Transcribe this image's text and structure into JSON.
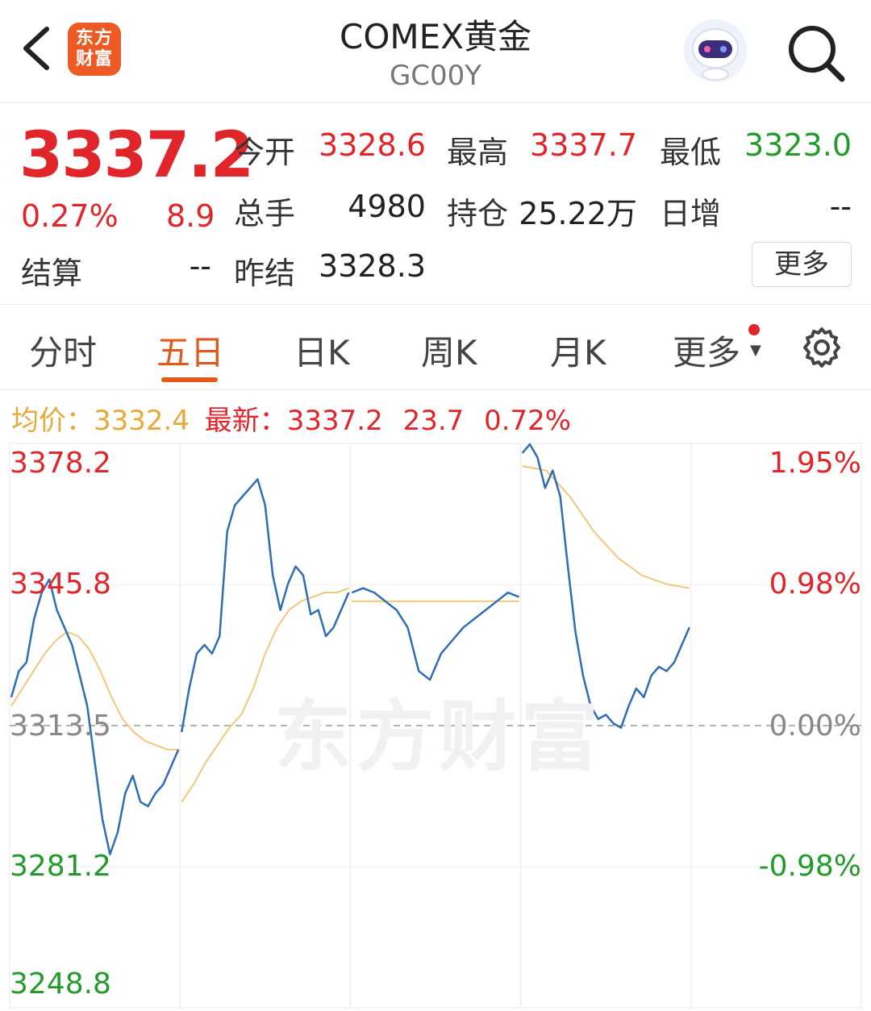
{
  "header": {
    "logo_line1": "东方",
    "logo_line2": "财富",
    "title": "COMEX黄金",
    "code": "GC00Y"
  },
  "quote": {
    "price": "3337.2",
    "change_pct": "0.27%",
    "change": "8.9",
    "open_label": "今开",
    "open": "3328.6",
    "high_label": "最高",
    "high": "3337.7",
    "low_label": "最低",
    "low": "3323.0",
    "volume_label": "总手",
    "volume": "4980",
    "oi_label": "持仓",
    "oi": "25.22万",
    "daily_inc_label": "日增",
    "daily_inc": "--",
    "settle_label": "结算",
    "settle": "--",
    "prev_settle_label": "昨结",
    "prev_settle": "3328.3",
    "more_button": "更多"
  },
  "tabs": [
    {
      "label": "分时",
      "active": false
    },
    {
      "label": "五日",
      "active": true
    },
    {
      "label": "日K",
      "active": false
    },
    {
      "label": "周K",
      "active": false
    },
    {
      "label": "月K",
      "active": false
    },
    {
      "label": "更多",
      "active": false
    }
  ],
  "info_line": {
    "avg_label": "均价：",
    "avg_value": "3332.4",
    "latest_label": "最新：",
    "latest_value": "3337.2",
    "latest_change": "23.7",
    "latest_pct": "0.72%"
  },
  "colors": {
    "up": "#e0262b",
    "down": "#239b2b",
    "price_line": "#2f6db5",
    "avg_line": "#efc97a",
    "accent": "#e05a1e"
  },
  "chart_data": {
    "type": "line",
    "title": "",
    "y_left_ticks": [
      "3378.2",
      "3345.8",
      "3313.5",
      "3281.2",
      "3248.8"
    ],
    "y_right_ticks": [
      "1.95%",
      "0.98%",
      "0.00%",
      "-0.98%",
      ""
    ],
    "ylim": [
      3248.8,
      3378.2
    ],
    "reference_value": 3313.5,
    "days": 5,
    "series": [
      {
        "values": [
          [
            3320,
            3326,
            3328,
            3338,
            3344,
            3347,
            3340,
            3336,
            3332,
            3325,
            3318,
            3305,
            3292,
            3284,
            3289,
            3298,
            3302,
            3296,
            3295,
            3298,
            3300,
            3304,
            3308
          ],
          [
            3312,
            3322,
            3330,
            3332,
            3330,
            3334,
            3358,
            3364,
            3366,
            3368,
            3370,
            3364,
            3348,
            3340,
            3346,
            3350,
            3348,
            3339,
            3340,
            3334,
            3336,
            3340,
            3344
          ],
          [
            3344,
            3345,
            3344,
            3342,
            3340,
            3336,
            3326,
            3324,
            3330,
            3333,
            3336,
            3338,
            3340,
            3342,
            3344,
            3343
          ],
          [
            3376,
            3378,
            3375,
            3368,
            3372,
            3366,
            3350,
            3335,
            3325,
            3318,
            3315,
            3316,
            3314,
            3313,
            3318,
            3322,
            3320,
            3325,
            3327,
            3326,
            3328,
            3332,
            3336
          ],
          []
        ]
      },
      {
        "values": [
          [
            3318,
            3322,
            3326,
            3330,
            3333,
            3335,
            3334,
            3331,
            3326,
            3320,
            3315,
            3312,
            3310,
            3309,
            3308,
            3308
          ],
          [
            3296,
            3300,
            3305,
            3309,
            3313,
            3316,
            3322,
            3330,
            3336,
            3340,
            3342,
            3343,
            3344,
            3344,
            3345
          ],
          [
            3342,
            3342,
            3342,
            3342,
            3342
          ],
          [
            3373,
            3372,
            3366,
            3358,
            3352,
            3348,
            3346,
            3345
          ],
          []
        ]
      }
    ]
  }
}
